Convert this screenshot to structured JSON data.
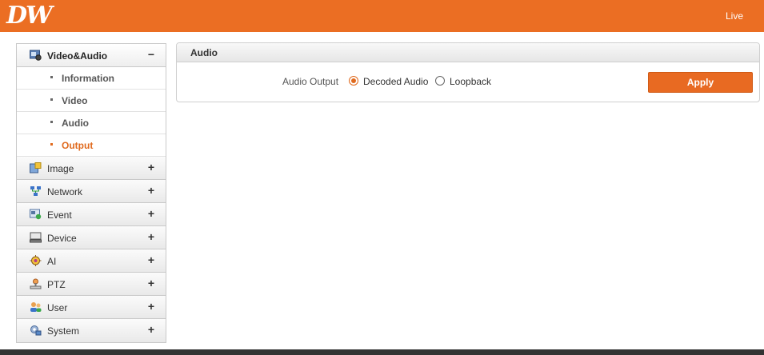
{
  "header": {
    "logo": "DW",
    "live_link": "Live",
    "bg_color": "#eb6e23"
  },
  "sidebar": {
    "expanded_group": {
      "label": "Video&Audio",
      "toggle": "−",
      "icon": "video-audio-icon",
      "items": [
        {
          "label": "Information",
          "active": false
        },
        {
          "label": "Video",
          "active": false
        },
        {
          "label": "Audio",
          "active": false
        },
        {
          "label": "Output",
          "active": true
        }
      ]
    },
    "groups": [
      {
        "label": "Image",
        "toggle": "+",
        "icon": "image-icon"
      },
      {
        "label": "Network",
        "toggle": "+",
        "icon": "network-icon"
      },
      {
        "label": "Event",
        "toggle": "+",
        "icon": "event-icon"
      },
      {
        "label": "Device",
        "toggle": "+",
        "icon": "device-icon"
      },
      {
        "label": "AI",
        "toggle": "+",
        "icon": "ai-icon"
      },
      {
        "label": "PTZ",
        "toggle": "+",
        "icon": "ptz-icon"
      },
      {
        "label": "User",
        "toggle": "+",
        "icon": "user-icon"
      },
      {
        "label": "System",
        "toggle": "+",
        "icon": "system-icon"
      }
    ]
  },
  "panel": {
    "title": "Audio",
    "field_label": "Audio Output",
    "options": [
      {
        "label": "Decoded Audio",
        "checked": true
      },
      {
        "label": "Loopback",
        "checked": false
      }
    ],
    "apply_label": "Apply"
  },
  "accent_color": "#e06a1e"
}
